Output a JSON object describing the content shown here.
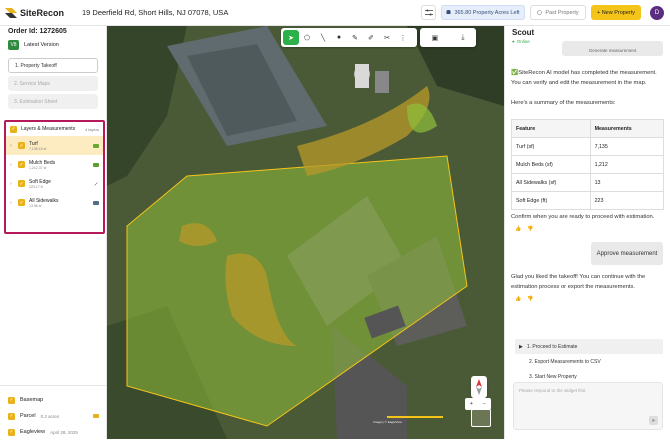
{
  "app": {
    "name": "SiteRecon",
    "address": "19 Deerfield Rd, Short Hills, NJ 07078, USA"
  },
  "topbar": {
    "acres_label": "365.80 Property Acres Left",
    "past_property": "Past Property",
    "new_property": "+ New Property",
    "avatar_initial": "D",
    "colors": {
      "accent": "#f5c418",
      "acres_bg": "#e6eefb",
      "avatar": "#5a2d82"
    }
  },
  "sidebar": {
    "order_id": "Order Id: 1272605",
    "version_badge": "V8",
    "version_label": "Latest Version",
    "steps": [
      "1. Property Takeoff",
      "2. Service Maps",
      "3. Estimation Sheet"
    ],
    "layers_title": "Layers & Measurements",
    "layers_count": "4 layers",
    "layers": [
      {
        "name": "Turf",
        "sub": "7,135.16 sf",
        "icon": "polygon-icon",
        "color": "#6aa832"
      },
      {
        "name": "Mulch Beds",
        "sub": "1,212.37 sf",
        "icon": "polygon-icon",
        "color": "#5c9e2c"
      },
      {
        "name": "Soft Edge",
        "sub": "223.17 ft",
        "icon": "line-icon",
        "color": "#555555"
      },
      {
        "name": "All Sidewalks",
        "sub": "13.56 sf",
        "icon": "polygon-icon",
        "color": "#556b8a"
      }
    ],
    "base_layers": [
      {
        "name": "Basemap",
        "sub": ""
      },
      {
        "name": "Parcel",
        "sub": "0.2 acres"
      },
      {
        "name": "Eagleview",
        "sub": "April 28, 2025"
      }
    ]
  },
  "map": {
    "tools": [
      "select-icon",
      "lasso-icon",
      "line-icon",
      "point-icon",
      "edit-icon",
      "pen-icon",
      "scissors-icon",
      "more-icon"
    ],
    "tools_right": [
      "image-icon",
      "download-icon"
    ],
    "footer": "Imagery © EagleView"
  },
  "scout": {
    "title": "Scout",
    "status": "Online",
    "top_bubble": "Generate measurement",
    "completed": "✅SiteRecon AI model has completed the measurement. You can verify and edit the measurement in the map.",
    "summary_intro": "Here's a summary of the measurements:",
    "table": {
      "headers": [
        "Feature",
        "Measurements"
      ],
      "rows": [
        [
          "Turf (sf)",
          "7,135"
        ],
        [
          "Mulch Beds (sf)",
          "1,212"
        ],
        [
          "All Sidewalks (sf)",
          "13"
        ],
        [
          "Soft Edge (ft)",
          "223"
        ]
      ]
    },
    "confirm": "Confirm when you are ready to proceed with estimation.",
    "approve_bubble": "Approve measurement",
    "glad": "Glad you liked the takeoff! You can continue with the estimation process or export the measurements.",
    "options": [
      "1. Proceed to Estimate",
      "2. Export Measurements to CSV",
      "3. Start New Property"
    ],
    "input_placeholder": "Please respond to the widget first"
  }
}
